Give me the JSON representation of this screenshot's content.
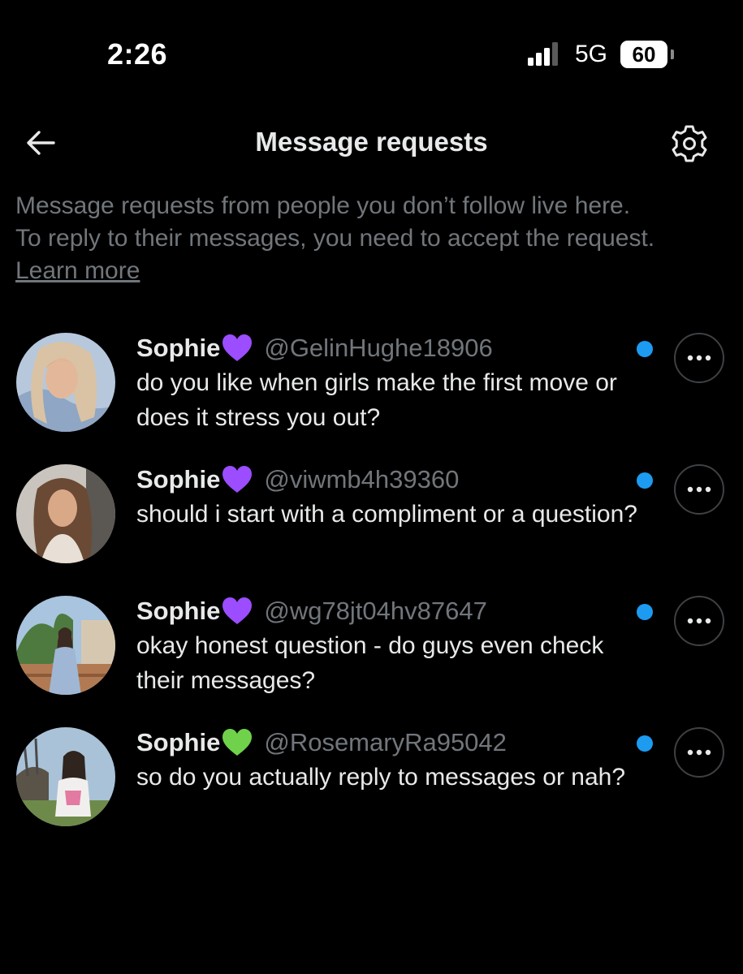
{
  "status_bar": {
    "time": "2:26",
    "network": "5G",
    "battery": "60",
    "icons": [
      "signal-bars-icon",
      "battery-icon"
    ]
  },
  "header": {
    "title": "Message requests",
    "back_icon": "arrow-left-icon",
    "settings_icon": "gear-icon"
  },
  "info": {
    "line1": "Message requests from people you don’t follow live here.",
    "line2": "To reply to their messages, you need to accept the request.",
    "link": "Learn more"
  },
  "requests": [
    {
      "name": "Sophie",
      "heart_icon": "purple-heart-icon",
      "heart_color": "#9b4dff",
      "handle": "@GelinHughe18906",
      "message": "do you like when girls make the first move or does it stress you out?",
      "unread": true
    },
    {
      "name": "Sophie",
      "heart_icon": "purple-heart-icon",
      "heart_color": "#9b4dff",
      "handle": "@viwmb4h39360",
      "message": "should i start with a compliment or a question?",
      "unread": true
    },
    {
      "name": "Sophie",
      "heart_icon": "purple-heart-icon",
      "heart_color": "#9b4dff",
      "handle": "@wg78jt04hv87647",
      "message": "okay honest question - do guys even check their messages?",
      "unread": true
    },
    {
      "name": "Sophie",
      "heart_icon": "green-heart-icon",
      "heart_color": "#6fd24a",
      "handle": "@RosemaryRa95042",
      "message": "so do you actually reply to messages or nah?",
      "unread": true
    }
  ],
  "colors": {
    "background": "#000000",
    "primary_text": "#e7e9ea",
    "secondary_text": "#71767b",
    "unread_dot": "#1d9bf0",
    "border": "#3e4144"
  }
}
